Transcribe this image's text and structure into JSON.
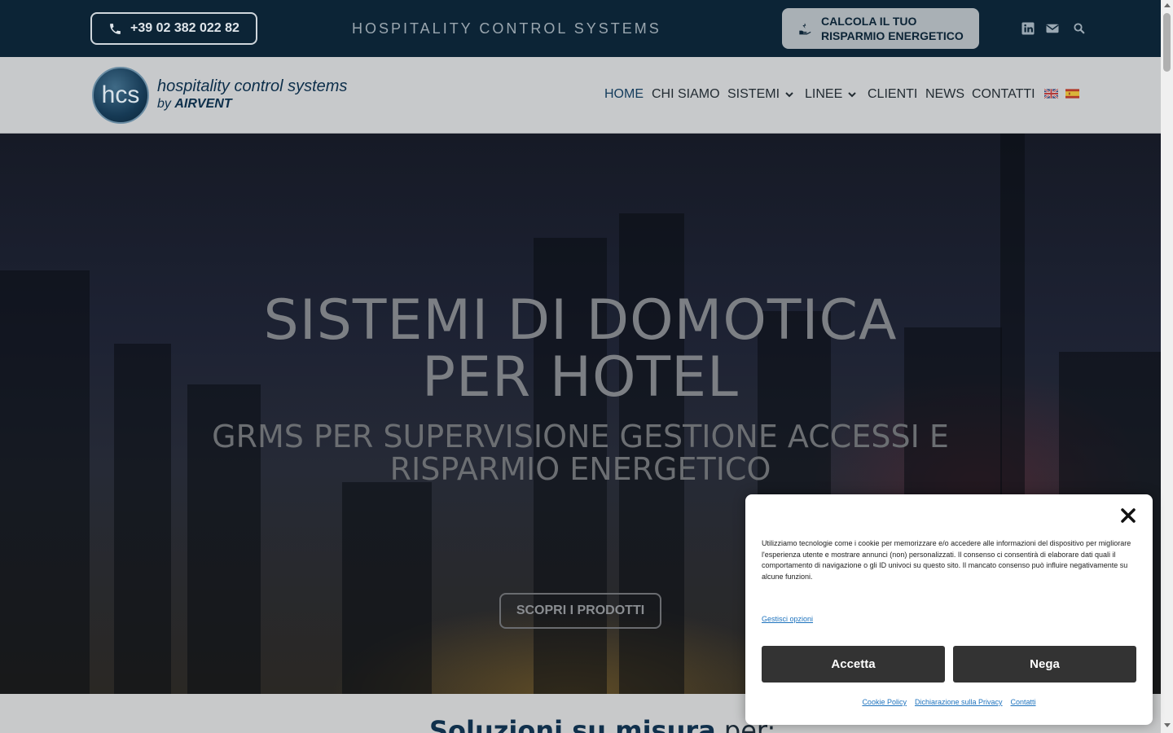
{
  "topbar": {
    "phone": "+39 02 382 022 82",
    "tagline": "HOSPITALITY CONTROL SYSTEMS",
    "calc_line1": "CALCOLA IL TUO",
    "calc_line2": "RISPARMIO ENERGETICO",
    "icons": [
      "linkedin-icon",
      "email-icon",
      "search-icon"
    ]
  },
  "header": {
    "logo_initials": "hcs",
    "logo_line1": "hospitality control systems",
    "logo_line2_prefix": "by",
    "logo_line2_brand": "AIRVENT",
    "nav": {
      "home": "HOME",
      "about": "CHI SIAMO",
      "systems": "SISTEMI",
      "lines": "LINEE",
      "clients": "CLIENTI",
      "news": "NEWS",
      "contacts": "CONTATTI"
    },
    "flags": [
      "uk-flag",
      "spain-flag"
    ]
  },
  "hero": {
    "title_line1": "SISTEMI DI DOMOTICA",
    "title_line2": "PER HOTEL",
    "subtitle_line1": "GRMS PER SUPERVISIONE GESTIONE ACCESSI E",
    "subtitle_line2": "RISPARMIO ENERGETICO",
    "cta": "SCOPRI I PRODOTTI"
  },
  "section": {
    "title_bold": "Soluzioni su misura",
    "title_rest": " per:"
  },
  "cookie": {
    "text": "Utilizziamo tecnologie come i cookie per memorizzare e/o accedere alle informazioni del dispositivo per migliorare l'esperienza utente e mostrare annunci (non) personalizzati. Il consenso ci consentirà di elaborare dati quali il comportamento di navigazione o gli ID univoci su questo sito. Il mancato consenso può influire negativamente su alcune funzioni.",
    "manage": "Gestisci opzioni",
    "accept": "Accetta",
    "deny": "Nega",
    "links": {
      "cookie_policy": "Cookie Policy",
      "privacy": "Dichiarazione sulla Privacy",
      "contacts": "Contatti"
    }
  },
  "colors": {
    "topbar_bg": "#0c2436",
    "brand_blue": "#133b5c",
    "cookie_button": "#333333",
    "link_blue": "#1e73be"
  }
}
